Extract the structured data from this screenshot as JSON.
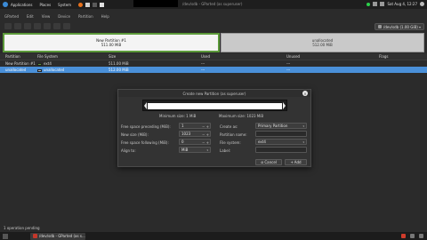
{
  "top_panel": {
    "menu": [
      "Applications",
      "Places",
      "System"
    ],
    "window_title": "/dev/sdb - GParted (as superuser)",
    "clock": "Sat Aug 4, 12:27"
  },
  "menubar": [
    "GParted",
    "Edit",
    "View",
    "Device",
    "Partition",
    "Help"
  ],
  "device_selector": "/dev/sdb (1.00 GiB)",
  "disk_graphic": {
    "used": {
      "name": "New Partition #1",
      "size": "511.00 MiB"
    },
    "free": {
      "name": "unallocated",
      "size": "512.00 MiB"
    }
  },
  "table": {
    "headers": [
      "Partition",
      "File System",
      "Size",
      "Used",
      "Unused",
      "Flags"
    ],
    "rows": [
      {
        "partition": "New Partition #1",
        "fs": "ext4",
        "size": "511.00 MiB",
        "used": "---",
        "unused": "---",
        "flags": ""
      },
      {
        "partition": "unallocated",
        "fs": "unallocated",
        "size": "512.00 MiB",
        "used": "---",
        "unused": "---",
        "flags": ""
      }
    ]
  },
  "dialog": {
    "title": "Create new Partition (as superuser)",
    "min_size": "Minimum size: 1 MiB",
    "max_size": "Maximum size: 1023 MiB",
    "fields": {
      "free_preceding_label": "Free space preceding (MiB):",
      "free_preceding_value": "1",
      "new_size_label": "New size (MiB):",
      "new_size_value": "1023",
      "free_following_label": "Free space following (MiB):",
      "free_following_value": "0",
      "align_label": "Align to:",
      "align_value": "MiB",
      "create_as_label": "Create as:",
      "create_as_value": "Primary Partition",
      "partition_name_label": "Partition name:",
      "fs_label": "File system:",
      "fs_value": "ext4",
      "label_label": "Label:"
    },
    "cancel": "Cancel",
    "add": "Add"
  },
  "statusbar": "1 operation pending",
  "taskbar": {
    "task": "/dev/sdb - GParted (as s..."
  }
}
